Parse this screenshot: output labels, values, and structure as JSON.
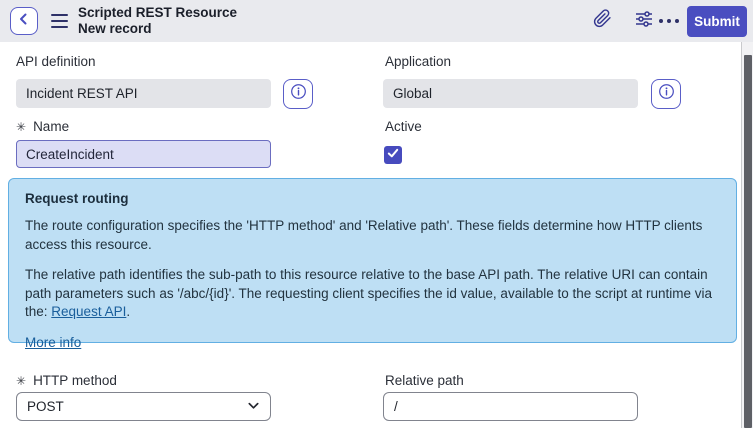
{
  "header": {
    "title": "Scripted REST Resource",
    "subtitle": "New record",
    "submit_label": "Submit"
  },
  "form": {
    "api_definition": {
      "label": "API definition",
      "value": "Incident REST API"
    },
    "application": {
      "label": "Application",
      "value": "Global"
    },
    "name": {
      "label": "Name",
      "required_marker": "✳",
      "value": "CreateIncident"
    },
    "active": {
      "label": "Active",
      "checked": true
    },
    "http_method": {
      "label": "HTTP method",
      "required_marker": "✳",
      "value": "POST"
    },
    "relative_path": {
      "label": "Relative path",
      "value": "/"
    }
  },
  "info_panel": {
    "title": "Request routing",
    "paragraph1": "The route configuration specifies the 'HTTP method' and 'Relative path'. These fields determine how HTTP clients access this resource.",
    "paragraph2_text": "The relative path identifies the sub-path to this resource relative to the base API path. The relative URI can contain path parameters such as '/abc/{id}'. The requesting client specifies the id value, available to the script at runtime via the: ",
    "request_api_link": "Request API",
    "paragraph2_period": ".",
    "more_info_link": "More info"
  },
  "colors": {
    "accent_purple": "#4a4ec0",
    "header_bg": "#e9eaee",
    "panel_bg": "#bedff4",
    "panel_border": "#62afe3",
    "link_blue": "#195e9b",
    "readonly_field_bg": "#e3e4e8",
    "focused_field_bg": "#dcddf5",
    "focused_field_border": "#6b6dc0",
    "checkbox_checked": "#474bbe",
    "scrollbar_thumb": "#5e6066"
  }
}
